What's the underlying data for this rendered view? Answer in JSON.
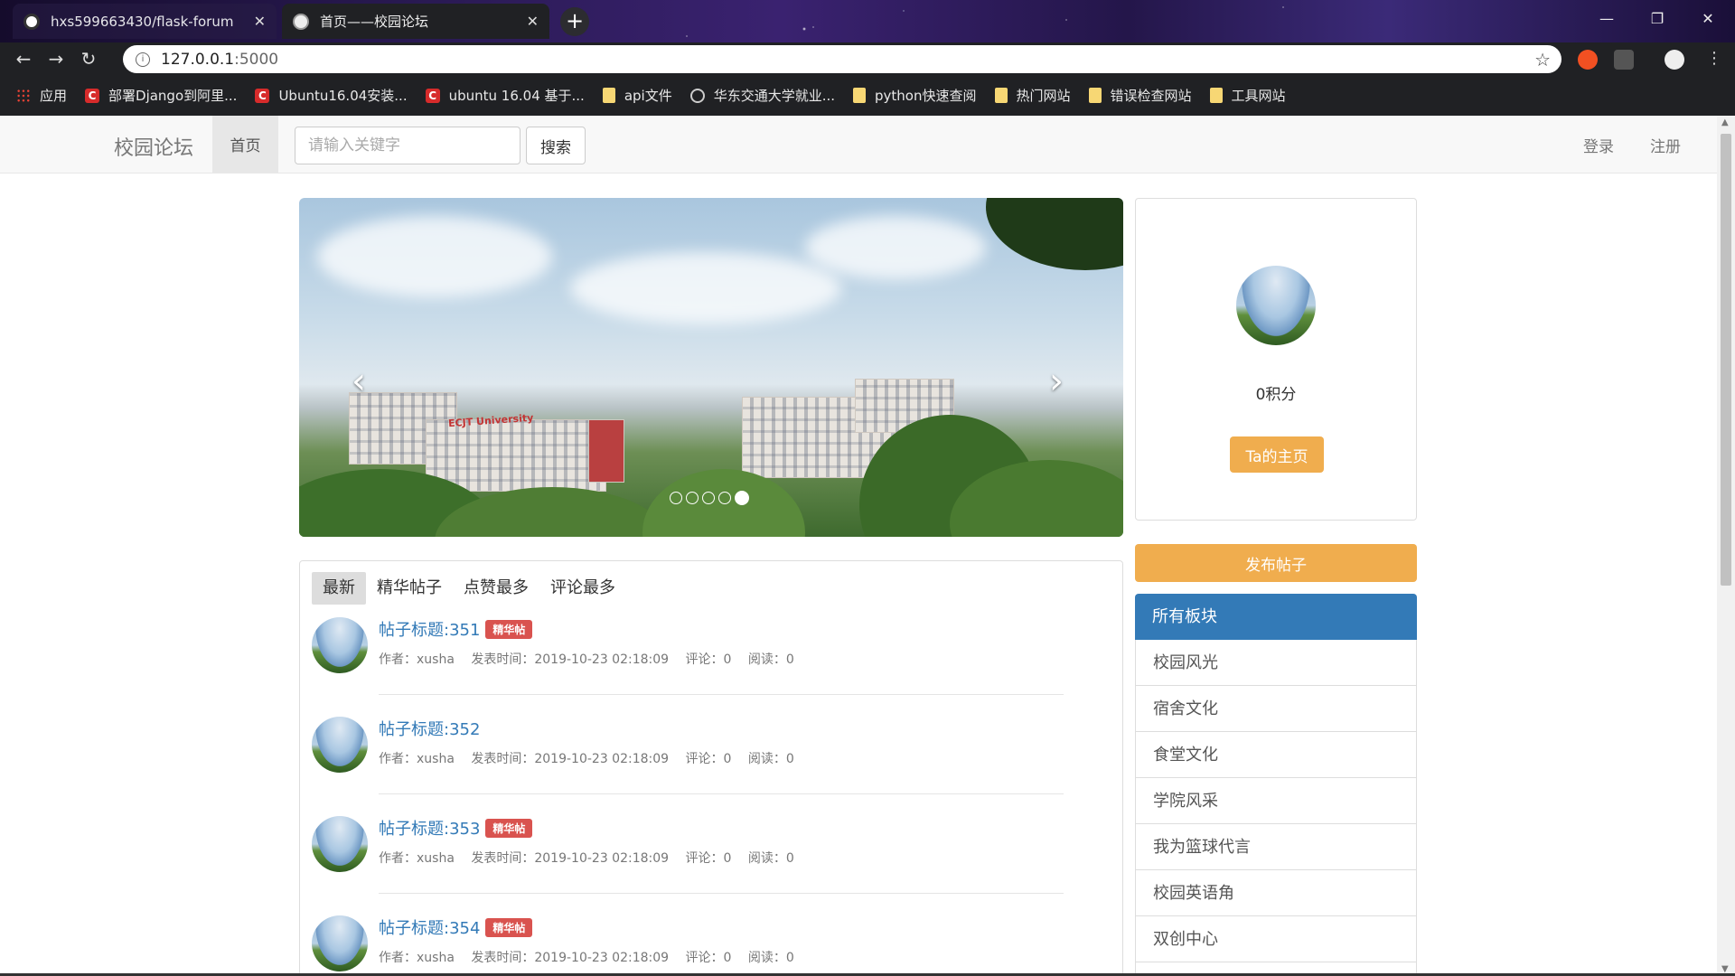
{
  "browser": {
    "tabs": [
      {
        "title": "hxs599663430/flask-forum"
      },
      {
        "title": "首页——校园论坛"
      }
    ],
    "address": {
      "host": "127.0.0.1",
      "port": ":5000"
    },
    "bookmarks": [
      {
        "label": "应用",
        "icon": "apps-grid-icon"
      },
      {
        "label": "部署Django到阿里...",
        "icon": "csdn-icon"
      },
      {
        "label": "Ubuntu16.04安装...",
        "icon": "csdn-icon"
      },
      {
        "label": "ubuntu 16.04 基于...",
        "icon": "csdn-icon"
      },
      {
        "label": "api文件",
        "icon": "folder-icon"
      },
      {
        "label": "华东交通大学就业...",
        "icon": "globe-icon"
      },
      {
        "label": "python快速查阅",
        "icon": "folder-icon"
      },
      {
        "label": "热门网站",
        "icon": "folder-icon"
      },
      {
        "label": "错误检查网站",
        "icon": "folder-icon"
      },
      {
        "label": "工具网站",
        "icon": "folder-icon"
      }
    ]
  },
  "navbar": {
    "brand": "校园论坛",
    "home": "首页",
    "search_placeholder": "请输入关键字",
    "search_button": "搜索",
    "login": "登录",
    "register": "注册"
  },
  "carousel": {
    "sign_text": "ECJT University",
    "slide_count": 5,
    "active_slide": 5
  },
  "profile": {
    "points": "0积分",
    "home_button": "Ta的主页"
  },
  "publish_button": "发布帖子",
  "boards": {
    "header": "所有板块",
    "items": [
      "校园风光",
      "宿舍文化",
      "食堂文化",
      "学院风采",
      "我为篮球代言",
      "校园英语角",
      "双创中心"
    ]
  },
  "post_tabs": [
    "最新",
    "精华帖子",
    "点赞最多",
    "评论最多"
  ],
  "posts": [
    {
      "title": "帖子标题:351",
      "badge": "精华帖",
      "author": "作者：xusha",
      "time": "发表时间：2019-10-23 02:18:09",
      "comments": "评论：0",
      "reads": "阅读：0"
    },
    {
      "title": "帖子标题:352",
      "badge": "",
      "author": "作者：xusha",
      "time": "发表时间：2019-10-23 02:18:09",
      "comments": "评论：0",
      "reads": "阅读：0"
    },
    {
      "title": "帖子标题:353",
      "badge": "精华帖",
      "author": "作者：xusha",
      "time": "发表时间：2019-10-23 02:18:09",
      "comments": "评论：0",
      "reads": "阅读：0"
    },
    {
      "title": "帖子标题:354",
      "badge": "精华帖",
      "author": "作者：xusha",
      "time": "发表时间：2019-10-23 02:18:09",
      "comments": "评论：0",
      "reads": "阅读：0"
    }
  ],
  "colors": {
    "primary": "#337ab7",
    "warning": "#f0ad4e",
    "danger": "#d9534f"
  }
}
